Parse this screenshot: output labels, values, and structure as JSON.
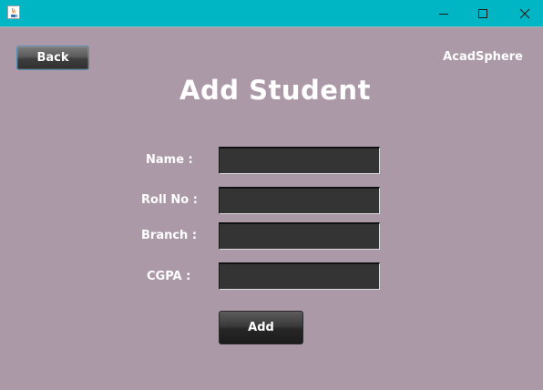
{
  "titlebar": {
    "icons": {
      "app": "java-cup-icon",
      "minimize": "minimize-icon",
      "maximize": "maximize-icon",
      "close": "close-icon"
    },
    "background": "#00b6c4"
  },
  "header": {
    "back_label": "Back",
    "brand": "AcadSphere",
    "title": "Add Student"
  },
  "form": {
    "fields": [
      {
        "label": "Name :",
        "value": ""
      },
      {
        "label": "Roll No :",
        "value": ""
      },
      {
        "label": "Branch :",
        "value": ""
      },
      {
        "label": "CGPA :",
        "value": ""
      }
    ],
    "submit_label": "Add"
  },
  "colors": {
    "background": "#ab99a7",
    "input_background": "#343434",
    "text": "#ffffff"
  }
}
